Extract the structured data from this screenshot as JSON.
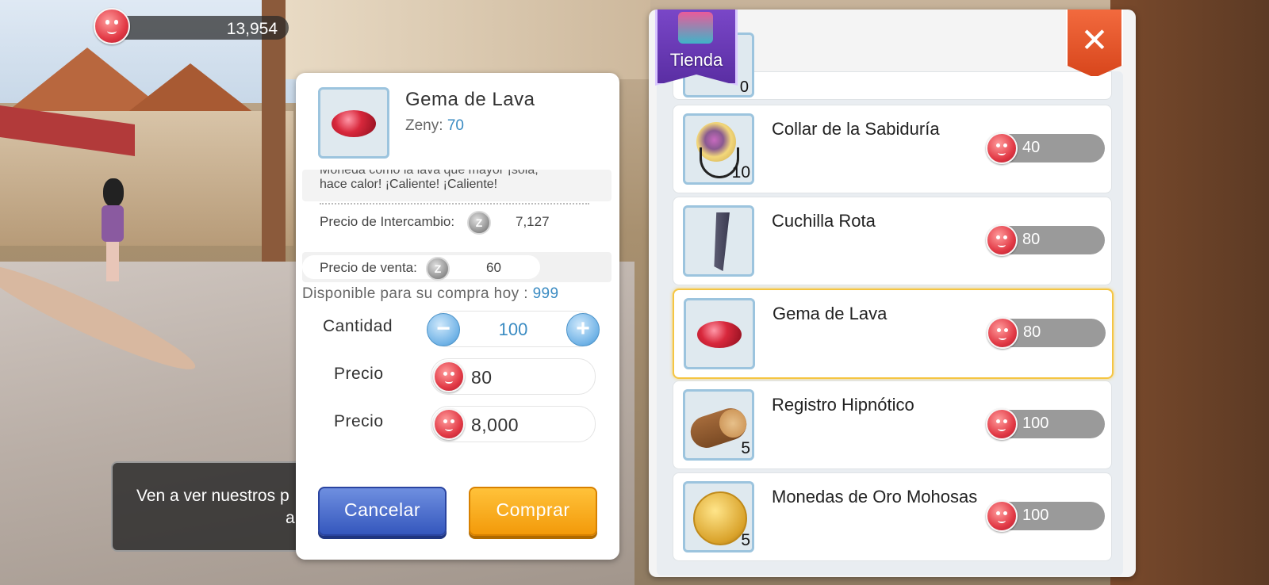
{
  "zeny_counter": {
    "value": "13,954"
  },
  "detail": {
    "item_name": "Gema de Lava",
    "zeny_label": "Zeny:",
    "zeny_value": "70",
    "description_cut": "Moneda como la lava que mayor ¡sola,",
    "description_line": "hace calor! ¡Caliente! ¡Caliente!",
    "exchange_label": "Precio de Intercambio:",
    "exchange_value": "7,127",
    "sale_label": "Precio de venta:",
    "sale_value": "60",
    "zeny_coin_symbol": "Z",
    "available_label": "Disponible para su compra hoy :",
    "available_value": "999",
    "quantity_label": "Cantidad",
    "quantity_value": "100",
    "minus_symbol": "−",
    "plus_symbol": "+",
    "unit_price_label": "Precio",
    "unit_price_value": "80",
    "total_price_label": "Precio",
    "total_price_value": "8,000",
    "cancel_label": "Cancelar",
    "buy_label": "Comprar"
  },
  "shop": {
    "title": "Tienda",
    "close_symbol": "✕",
    "partial_item_count": "0",
    "items": [
      {
        "name": "Collar de la Sabiduría",
        "count": "10",
        "price": "40",
        "icon": "necklace-icon"
      },
      {
        "name": "Cuchilla Rota",
        "count": "",
        "price": "80",
        "icon": "broken-blade-icon"
      },
      {
        "name": "Gema de Lava",
        "count": "",
        "price": "80",
        "icon": "lava-gem-icon",
        "selected": true
      },
      {
        "name": "Registro Hipnótico",
        "count": "5",
        "price": "100",
        "icon": "log-icon"
      },
      {
        "name": "Monedas de Oro Mohosas",
        "count": "5",
        "price": "100",
        "icon": "gold-coin-icon"
      }
    ]
  },
  "npc": {
    "text": "Ven a ver nuestros p",
    "text_tail": "a"
  },
  "colors": {
    "accent_blue": "#3a8bc2",
    "buy_orange": "#f39a0a",
    "cancel_blue": "#3557bd",
    "select_gold": "#f5c542"
  }
}
